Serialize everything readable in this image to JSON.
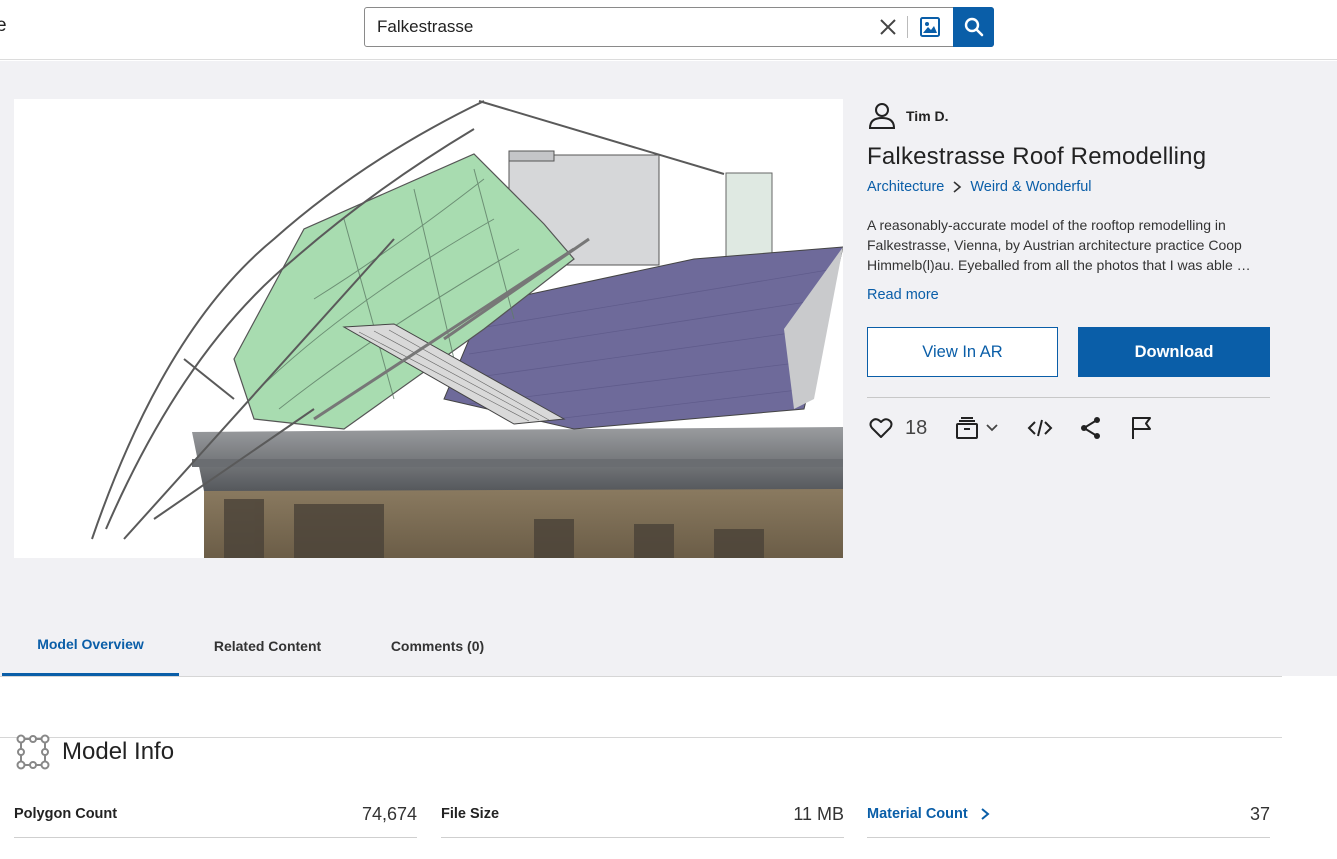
{
  "header": {
    "edge_glyph": "e",
    "search": {
      "value": "Falkestrasse",
      "placeholder": "Search"
    }
  },
  "model": {
    "author": "Tim D.",
    "title": "Falkestrasse Roof Remodelling",
    "breadcrumbs": [
      "Architecture",
      "Weird & Wonderful"
    ],
    "description": "A reasonably-accurate model of the rooftop remodelling in Falkestrasse, Vienna, by Austrian architecture practice Coop Himmelb(l)au. Eyeballed from all the photos that I was able …",
    "read_more": "Read more",
    "view_ar": "View In AR",
    "download": "Download",
    "likes": "18"
  },
  "icons": {
    "user": "user-icon",
    "close": "close-icon",
    "image_search": "image-search-icon",
    "search": "search-icon",
    "chevron_right": "chevron-right-icon",
    "heart": "heart-icon",
    "collection": "collection-icon",
    "chevron_down": "chevron-down-icon",
    "embed": "code-embed-icon",
    "share": "share-icon",
    "flag": "flag-icon",
    "model_info": "model-info-icon"
  },
  "tabs": [
    {
      "label": "Model Overview",
      "active": true
    },
    {
      "label": "Related Content",
      "active": false
    },
    {
      "label": "Comments (0)",
      "active": false
    }
  ],
  "model_info": {
    "heading": "Model Info",
    "stats": [
      {
        "label": "Polygon Count",
        "value": "74,674"
      },
      {
        "label": "File Size",
        "value": "11 MB"
      },
      {
        "label": "Material Count",
        "value": "37"
      }
    ]
  },
  "colors": {
    "accent": "#0a5ea8",
    "hero_bg": "#f1f1f4",
    "glass": "#a8dcb0",
    "roof": "#6e6a9a"
  }
}
